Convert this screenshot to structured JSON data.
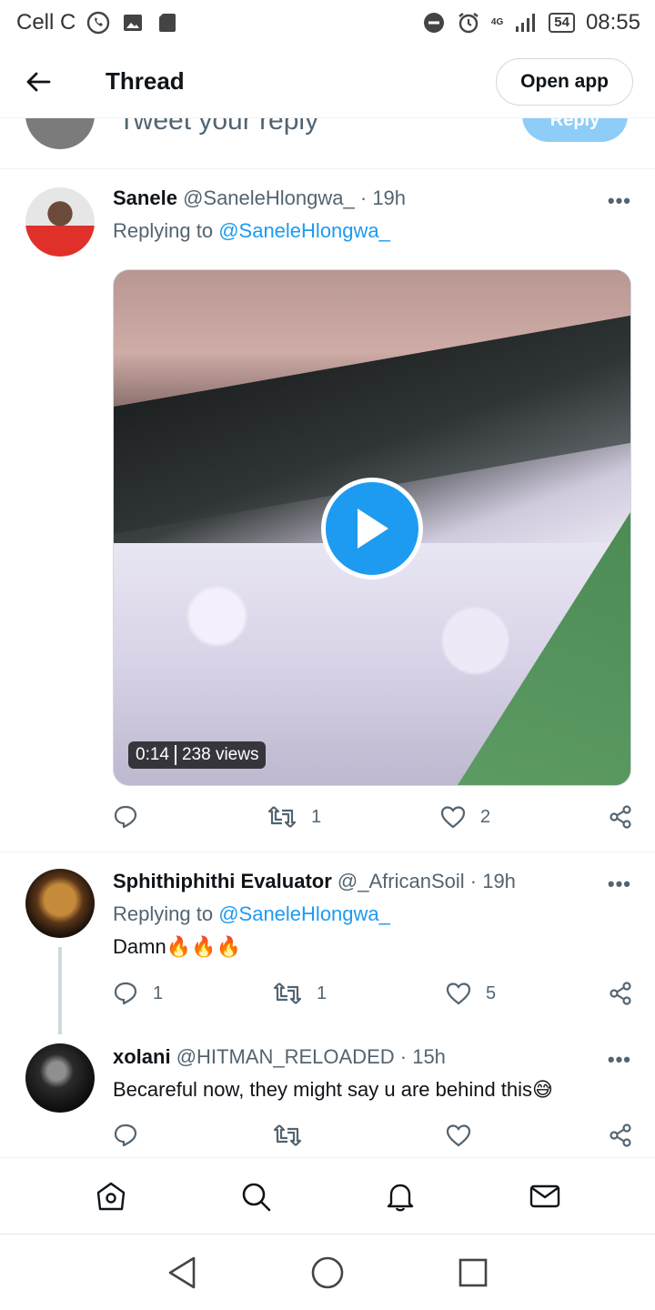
{
  "status_bar": {
    "carrier": "Cell C",
    "battery": "54",
    "network": "4G",
    "time": "08:55"
  },
  "header": {
    "title": "Thread",
    "open_app_label": "Open app"
  },
  "composer": {
    "placeholder": "Tweet your reply",
    "reply_label": "Reply"
  },
  "tweets": [
    {
      "name": "Sanele",
      "handle": "@SaneleHlongwa_",
      "time": "· 19h",
      "replying_prefix": "Replying to",
      "replying_to": "@SaneleHlongwa_",
      "video": {
        "duration": "0:14",
        "views": "238 views"
      },
      "counts": {
        "replies": "",
        "retweets": "1",
        "likes": "2"
      }
    },
    {
      "name": "Sphithiphithi Evaluator",
      "handle": "@_AfricanSoil",
      "time": "· 19h",
      "replying_prefix": "Replying to",
      "replying_to": "@SaneleHlongwa_",
      "text": "Damn🔥🔥🔥",
      "counts": {
        "replies": "1",
        "retweets": "1",
        "likes": "5"
      }
    },
    {
      "name": "xolani",
      "handle": "@HITMAN_RELOADED",
      "time": "· 15h",
      "text": "Becareful now, they might say u are behind this😅",
      "counts": {
        "replies": "",
        "retweets": "",
        "likes": ""
      }
    }
  ],
  "colors": {
    "accent": "#1d9bf0",
    "muted": "#536471",
    "text": "#0f1419"
  },
  "icons": [
    "whatsapp-icon",
    "image-icon",
    "sd-card-icon",
    "dnd-icon",
    "alarm-icon",
    "signal-icon",
    "battery-icon",
    "back-arrow-icon",
    "more-icon",
    "reply-icon",
    "retweet-icon",
    "like-icon",
    "share-icon",
    "home-icon",
    "search-icon",
    "notifications-icon",
    "messages-icon",
    "nav-back-icon",
    "nav-home-icon",
    "nav-recents-icon",
    "play-icon"
  ]
}
